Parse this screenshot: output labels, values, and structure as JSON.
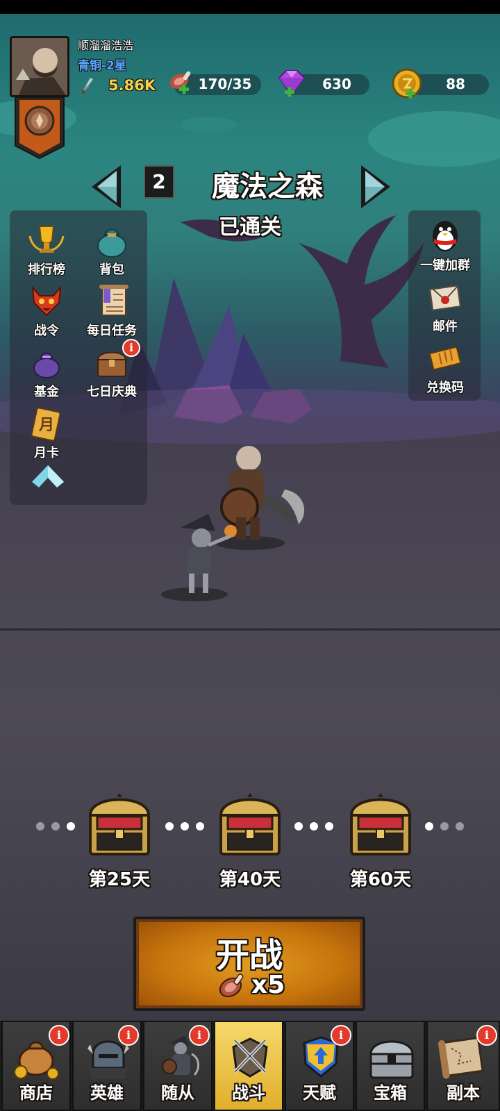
{
  "player": {
    "name": "顺溜溜浩浩",
    "rank": "青铜-2星",
    "power": "5.86K"
  },
  "resources": {
    "stamina": "170/35",
    "gems": "630",
    "coins": "88"
  },
  "level": {
    "number": "2",
    "title": "魔法之森",
    "status": "已通关"
  },
  "left_menu": [
    {
      "label": "排行榜",
      "icon": "trophy-icon"
    },
    {
      "label": "背包",
      "icon": "bag-icon"
    },
    {
      "label": "战令",
      "icon": "battle-pass-icon"
    },
    {
      "label": "每日任务",
      "icon": "scroll-icon"
    },
    {
      "label": "基金",
      "icon": "fund-bag-icon"
    },
    {
      "label": "七日庆典",
      "icon": "chest-icon"
    },
    {
      "label": "月卡",
      "icon": "month-card-icon"
    }
  ],
  "month_card_glyph": "月",
  "right_menu": [
    {
      "label": "一键加群",
      "icon": "penguin-icon"
    },
    {
      "label": "邮件",
      "icon": "mail-icon"
    },
    {
      "label": "兑换码",
      "icon": "ticket-icon"
    }
  ],
  "milestones": [
    {
      "label": "第25天"
    },
    {
      "label": "第40天"
    },
    {
      "label": "第60天"
    }
  ],
  "start_button": {
    "label": "开战",
    "cost": "x5"
  },
  "badge_glyph": "i",
  "tabs": [
    {
      "label": "商店",
      "icon": "shop-icon",
      "badge": true
    },
    {
      "label": "英雄",
      "icon": "hero-icon",
      "badge": true
    },
    {
      "label": "随从",
      "icon": "follower-icon",
      "badge": true
    },
    {
      "label": "战斗",
      "icon": "battle-icon",
      "badge": false,
      "active": true
    },
    {
      "label": "天赋",
      "icon": "talent-icon",
      "badge": true
    },
    {
      "label": "宝箱",
      "icon": "treasure-icon",
      "badge": false
    },
    {
      "label": "副本",
      "icon": "dungeon-map-icon",
      "badge": true
    }
  ],
  "colors": {
    "rank": "#59a7ff",
    "power": "#f5d24a",
    "badge": "#e33a2c",
    "start_button": "#d88a16",
    "active_tab": "#f2c84a"
  }
}
